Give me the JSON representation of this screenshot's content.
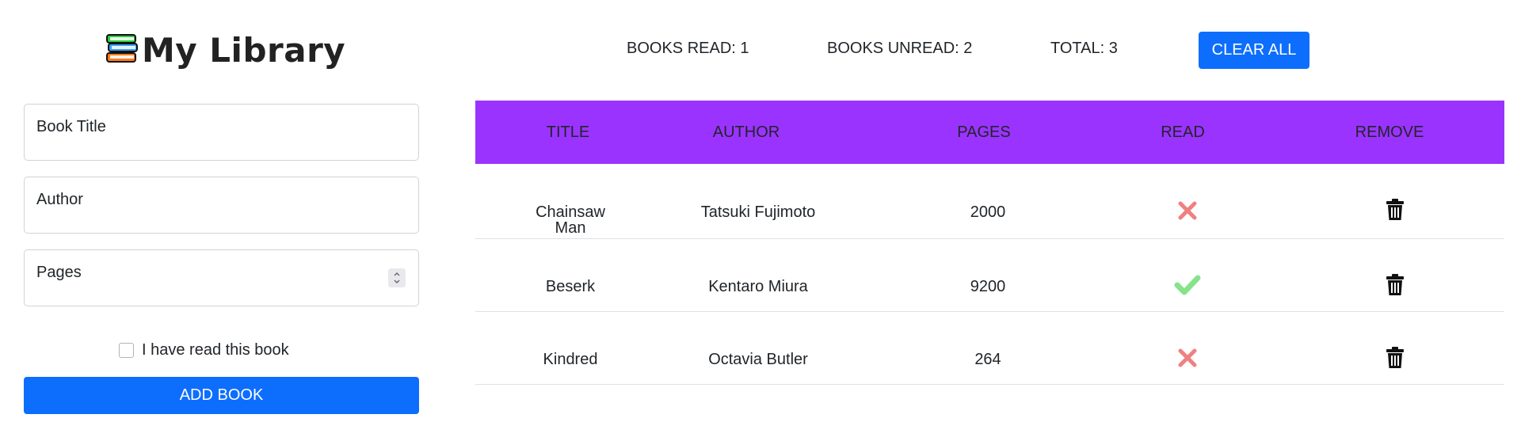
{
  "header": {
    "title": "My Library",
    "logo_icon": "books-icon"
  },
  "stats": {
    "read_label": "BOOKS READ: 1",
    "unread_label": "BOOKS UNREAD: 2",
    "total_label": "TOTAL: 3",
    "clear_label": "CLEAR ALL"
  },
  "form": {
    "title_placeholder": "Book Title",
    "author_placeholder": "Author",
    "pages_placeholder": "Pages",
    "read_checkbox_label": "I have read this book",
    "read_checked": false,
    "add_label": "ADD BOOK"
  },
  "table": {
    "columns": [
      "TITLE",
      "AUTHOR",
      "PAGES",
      "READ",
      "REMOVE"
    ],
    "rows": [
      {
        "title": "Chainsaw Man",
        "author": "Tatsuki Fujimoto",
        "pages": "2000",
        "read": false
      },
      {
        "title": "Beserk",
        "author": "Kentaro Miura",
        "pages": "9200",
        "read": true
      },
      {
        "title": "Kindred",
        "author": "Octavia Butler",
        "pages": "264",
        "read": false
      }
    ]
  },
  "colors": {
    "primary": "#0d6efd",
    "header_bg": "#9b33ff",
    "read_yes": "#86e38a",
    "read_no": "#f08080"
  }
}
